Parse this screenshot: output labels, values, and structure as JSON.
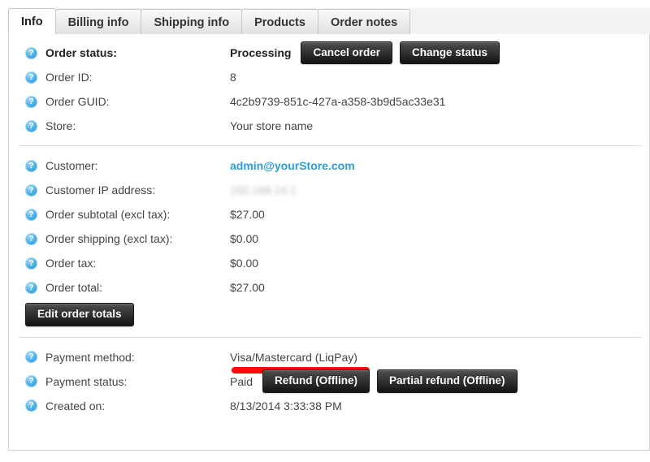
{
  "tabs": [
    {
      "label": "Info",
      "active": true
    },
    {
      "label": "Billing info",
      "active": false
    },
    {
      "label": "Shipping info",
      "active": false
    },
    {
      "label": "Products",
      "active": false
    },
    {
      "label": "Order notes",
      "active": false
    }
  ],
  "icons": {
    "help": "help-icon"
  },
  "colors": {
    "link": "#2a9fd8",
    "annotation": "#fa0a0a",
    "button_dark": "#303030"
  },
  "section_order": {
    "order_status": {
      "label": "Order status:",
      "value": "Processing",
      "cancel_button": "Cancel order",
      "change_button": "Change status"
    },
    "order_id": {
      "label": "Order ID:",
      "value": "8"
    },
    "order_guid": {
      "label": "Order GUID:",
      "value": "4c2b9739-851c-427a-a358-3b9d5ac33e31"
    },
    "store": {
      "label": "Store:",
      "value": "Your store name"
    }
  },
  "section_customer": {
    "customer": {
      "label": "Customer:",
      "value": "admin@yourStore.com"
    },
    "customer_ip": {
      "label": "Customer IP address:",
      "value": "192.168.14.1"
    },
    "order_subtotal": {
      "label": "Order subtotal (excl tax):",
      "value": "$27.00"
    },
    "order_shipping": {
      "label": "Order shipping (excl tax):",
      "value": "$0.00"
    },
    "order_tax": {
      "label": "Order tax:",
      "value": "$0.00"
    },
    "order_total": {
      "label": "Order total:",
      "value": "$27.00"
    },
    "edit_totals_button": "Edit order totals"
  },
  "section_payment": {
    "payment_method": {
      "label": "Payment method:",
      "value": "Visa/Mastercard (LiqPay)"
    },
    "payment_status": {
      "label": "Payment status:",
      "value": "Paid",
      "refund_button": "Refund (Offline)",
      "partial_refund_button": "Partial refund (Offline)"
    },
    "created_on": {
      "label": "Created on:",
      "value": "8/13/2014 3:33:38 PM"
    }
  }
}
